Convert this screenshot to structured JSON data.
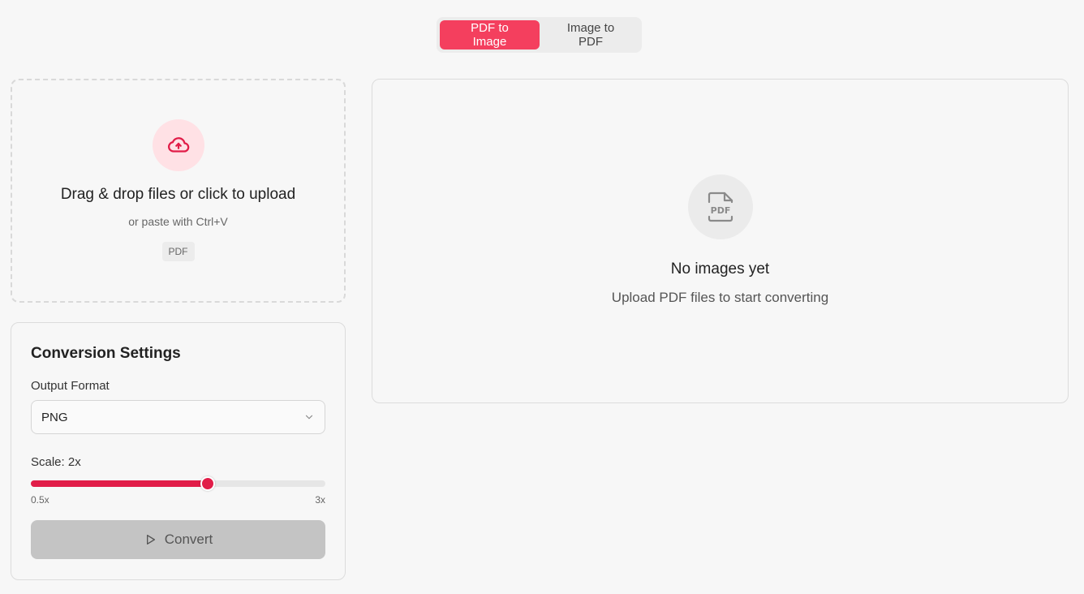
{
  "mode_toggle": {
    "pdf_to_image": "PDF to Image",
    "image_to_pdf": "Image to PDF",
    "active": "PDF to Image",
    "accent_color": "#f43f5e"
  },
  "dropzone": {
    "icon": "cloud-upload-icon",
    "title": "Drag & drop files or click to upload",
    "subtitle": "or paste with Ctrl+V",
    "accepted_badge": "PDF"
  },
  "settings": {
    "title": "Conversion Settings",
    "output_format_label": "Output Format",
    "output_format_value": "PNG",
    "scale_label": "Scale: 2x",
    "scale": {
      "min": 0.5,
      "max": 3,
      "value": 2,
      "min_label": "0.5x",
      "max_label": "3x"
    },
    "convert_label": "Convert",
    "convert_icon": "play-icon"
  },
  "preview": {
    "icon": "pdf-file-icon",
    "empty_title": "No images yet",
    "empty_subtitle": "Upload PDF files to start converting"
  }
}
